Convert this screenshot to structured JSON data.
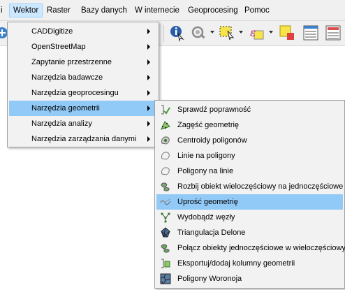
{
  "menubar": {
    "items": [
      {
        "label": "i"
      },
      {
        "label": "Wektor"
      },
      {
        "label": "Raster"
      },
      {
        "label": "Bazy danych"
      },
      {
        "label": "W internecie"
      },
      {
        "label": "Geoprocesing"
      },
      {
        "label": "Pomoc"
      }
    ]
  },
  "toolbar": {
    "icons": [
      "add-layer-icon",
      "identify-icon",
      "pan-to-selection-icon",
      "select-feature-icon",
      "expression-select-icon",
      "deselect-icon",
      "attribute-table-icon",
      "statistics-icon"
    ]
  },
  "vector_menu": {
    "items": [
      {
        "label": "CADDigitize"
      },
      {
        "label": "OpenStreetMap"
      },
      {
        "label": "Zapytanie przestrzenne"
      },
      {
        "label": "Narzędzia badawcze"
      },
      {
        "label": "Narzędzia geoprocesingu"
      },
      {
        "label": "Narzędzia geometrii"
      },
      {
        "label": "Narzędzia analizy"
      },
      {
        "label": "Narzędzia zarządzania danymi"
      }
    ]
  },
  "geometry_submenu": {
    "items": [
      {
        "label": "Sprawdź poprawność"
      },
      {
        "label": "Zagęść geometrię"
      },
      {
        "label": "Centroidy poligonów"
      },
      {
        "label": "Linie na poligony"
      },
      {
        "label": "Poligony na linie"
      },
      {
        "label": "Rozbij obiekt wieloczęściowy na jednoczęściowe"
      },
      {
        "label": "Uprość geometrię"
      },
      {
        "label": "Wydobądź węzły"
      },
      {
        "label": "Triangulacja Delone"
      },
      {
        "label": "Połącz obiekty jednoczęściowe w wieloczęściowy"
      },
      {
        "label": "Eksportuj/dodaj kolumny geometrii"
      },
      {
        "label": "Poligony Woronoja"
      }
    ]
  },
  "colors": {
    "highlight": "#91c9f7",
    "active_menu": "#cce8ff"
  }
}
